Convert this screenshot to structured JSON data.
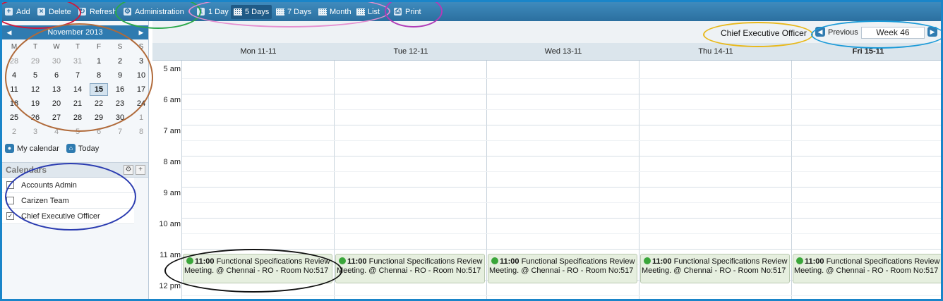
{
  "toolbar": {
    "add": "Add",
    "delete": "Delete",
    "refresh": "Refresh",
    "administration": "Administration",
    "one_day": "1 Day",
    "five_days": "5 Days",
    "seven_days": "7 Days",
    "month": "Month",
    "list": "List",
    "print": "Print"
  },
  "mini_calendar": {
    "title": "November 2013",
    "weekdays": [
      "M",
      "T",
      "W",
      "T",
      "F",
      "S",
      "S"
    ],
    "weeks": [
      [
        "28",
        "29",
        "30",
        "31",
        "1",
        "2",
        "3"
      ],
      [
        "4",
        "5",
        "6",
        "7",
        "8",
        "9",
        "10"
      ],
      [
        "11",
        "12",
        "13",
        "14",
        "15",
        "16",
        "17"
      ],
      [
        "18",
        "19",
        "20",
        "21",
        "22",
        "23",
        "24"
      ],
      [
        "25",
        "26",
        "27",
        "28",
        "29",
        "30",
        "1"
      ],
      [
        "2",
        "3",
        "4",
        "5",
        "6",
        "7",
        "8"
      ]
    ],
    "today": "15"
  },
  "shortcuts": {
    "my_calendar": "My calendar",
    "today": "Today"
  },
  "calendars": {
    "title": "Calendars",
    "items": [
      {
        "label": "Accounts Admin",
        "checked": false
      },
      {
        "label": "Carizen Team",
        "checked": false
      },
      {
        "label": "Chief Executive Officer",
        "checked": true
      }
    ]
  },
  "header": {
    "owner": "Chief Executive Officer",
    "previous": "Previous",
    "week": "Week 46"
  },
  "days": [
    "Mon 11-11",
    "Tue 12-11",
    "Wed 13-11",
    "Thu 14-11",
    "Fri 15-11"
  ],
  "times": [
    "5 am",
    "6 am",
    "7 am",
    "8 am",
    "9 am",
    "10 am",
    "11 am",
    "12 pm"
  ],
  "event": {
    "time": "11:00",
    "title": "Functional Specifications Review",
    "detail": "Meeting. @ Chennai - RO - Room No:517"
  },
  "colors": {
    "accent": "#2f7bb0",
    "event_bg": "#e6efdf",
    "event_dot": "#3aa63a"
  }
}
